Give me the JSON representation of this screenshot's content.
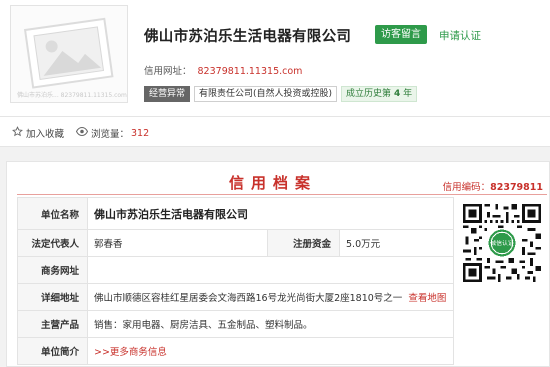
{
  "company": {
    "logo_watermark": "佛山市苏泊乐... 82379811.11315.com",
    "name": "佛山市苏泊乐生活电器有限公司",
    "visitor_button": "访客留言",
    "apply_link": "申请认证",
    "site_label": "信用网址：",
    "site_url": "82379811.11315.com",
    "tags": {
      "abnormal": "经营异常",
      "type": "有限责任公司(自然人投资或控股)",
      "history_prefix": "成立历史第",
      "history_num": "4",
      "history_suffix": "年"
    }
  },
  "stats": {
    "favorite_label": "加入收藏",
    "views_label": "浏览量：",
    "views_value": "312"
  },
  "credit": {
    "title": "信用档案",
    "code_label": "信用编码：",
    "code_value": "82379811",
    "rows": {
      "unit_name_k": "单位名称",
      "unit_name_v": "佛山市苏泊乐生活电器有限公司",
      "legal_rep_k": "法定代表人",
      "legal_rep_v": "郭春香",
      "capital_k": "注册资金",
      "capital_v": "5.0万元",
      "website_k": "商务网址",
      "website_v": "",
      "address_k": "详细地址",
      "address_v": "佛山市顺德区容桂红星居委会文海西路16号龙光尚街大厦2座1810号之一",
      "map_link": "查看地图",
      "products_k": "主营产品",
      "products_v": "销售：家用电器、厨房洁具、五金制品、塑料制品。",
      "intro_k": "单位简介",
      "intro_link": ">>更多商务信息"
    },
    "qr_badge": "诚信认证"
  },
  "colors": {
    "brand_red": "#c8312b",
    "brand_green": "#2e9a4a"
  }
}
